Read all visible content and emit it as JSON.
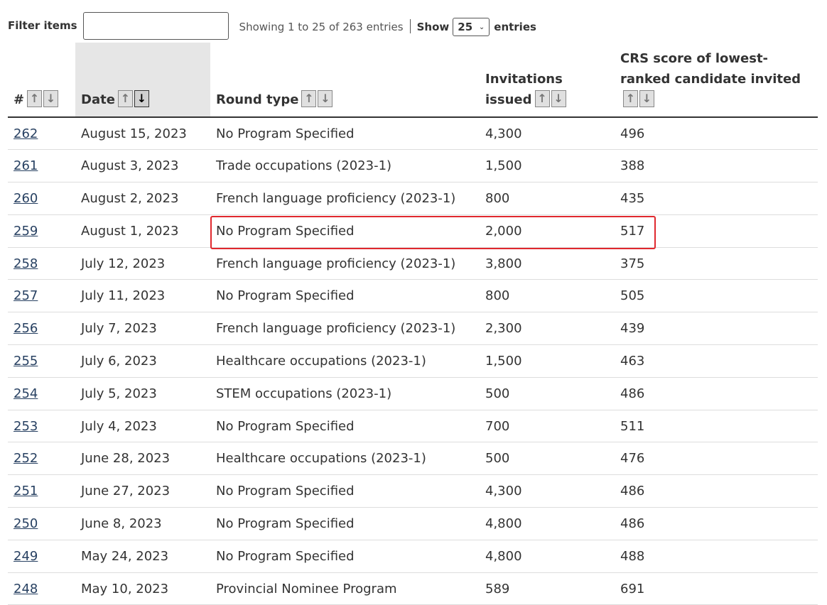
{
  "filter": {
    "label": "Filter items",
    "value": ""
  },
  "info": {
    "showing": "Showing 1 to 25 of 263 entries",
    "show_label": "Show",
    "page_size": "25",
    "entries_label": "entries"
  },
  "columns": [
    {
      "label": "#",
      "sorted": false
    },
    {
      "label": "Date",
      "sorted": true
    },
    {
      "label": "Round type",
      "sorted": false
    },
    {
      "label": "Invitations issued",
      "sorted": false
    },
    {
      "label": "CRS score of lowest-ranked candidate invited",
      "sorted": false
    }
  ],
  "rows": [
    {
      "num": "262",
      "date": "August 15, 2023",
      "type": "No Program Specified",
      "inv": "4,300",
      "crs": "496"
    },
    {
      "num": "261",
      "date": "August 3, 2023",
      "type": "Trade occupations (2023-1)",
      "inv": "1,500",
      "crs": "388"
    },
    {
      "num": "260",
      "date": "August 2, 2023",
      "type": "French language proficiency (2023-1)",
      "inv": "800",
      "crs": "435"
    },
    {
      "num": "259",
      "date": "August 1, 2023",
      "type": "No Program Specified",
      "inv": "2,000",
      "crs": "517"
    },
    {
      "num": "258",
      "date": "July 12, 2023",
      "type": "French language proficiency (2023-1)",
      "inv": "3,800",
      "crs": "375"
    },
    {
      "num": "257",
      "date": "July 11, 2023",
      "type": "No Program Specified",
      "inv": "800",
      "crs": "505"
    },
    {
      "num": "256",
      "date": "July 7, 2023",
      "type": "French language proficiency (2023-1)",
      "inv": "2,300",
      "crs": "439"
    },
    {
      "num": "255",
      "date": "July 6, 2023",
      "type": "Healthcare occupations (2023-1)",
      "inv": "1,500",
      "crs": "463"
    },
    {
      "num": "254",
      "date": "July 5, 2023",
      "type": "STEM occupations (2023-1)",
      "inv": "500",
      "crs": "486"
    },
    {
      "num": "253",
      "date": "July 4, 2023",
      "type": "No Program Specified",
      "inv": "700",
      "crs": "511"
    },
    {
      "num": "252",
      "date": "June 28, 2023",
      "type": "Healthcare occupations (2023-1)",
      "inv": "500",
      "crs": "476"
    },
    {
      "num": "251",
      "date": "June 27, 2023",
      "type": "No Program Specified",
      "inv": "4,300",
      "crs": "486"
    },
    {
      "num": "250",
      "date": "June 8, 2023",
      "type": "No Program Specified",
      "inv": "4,800",
      "crs": "486"
    },
    {
      "num": "249",
      "date": "May 24, 2023",
      "type": "No Program Specified",
      "inv": "4,800",
      "crs": "488"
    },
    {
      "num": "248",
      "date": "May 10, 2023",
      "type": "Provincial Nominee Program",
      "inv": "589",
      "crs": "691"
    }
  ],
  "highlight_row": "259",
  "colors": {
    "link": "#284162",
    "highlight": "#e0282e"
  }
}
